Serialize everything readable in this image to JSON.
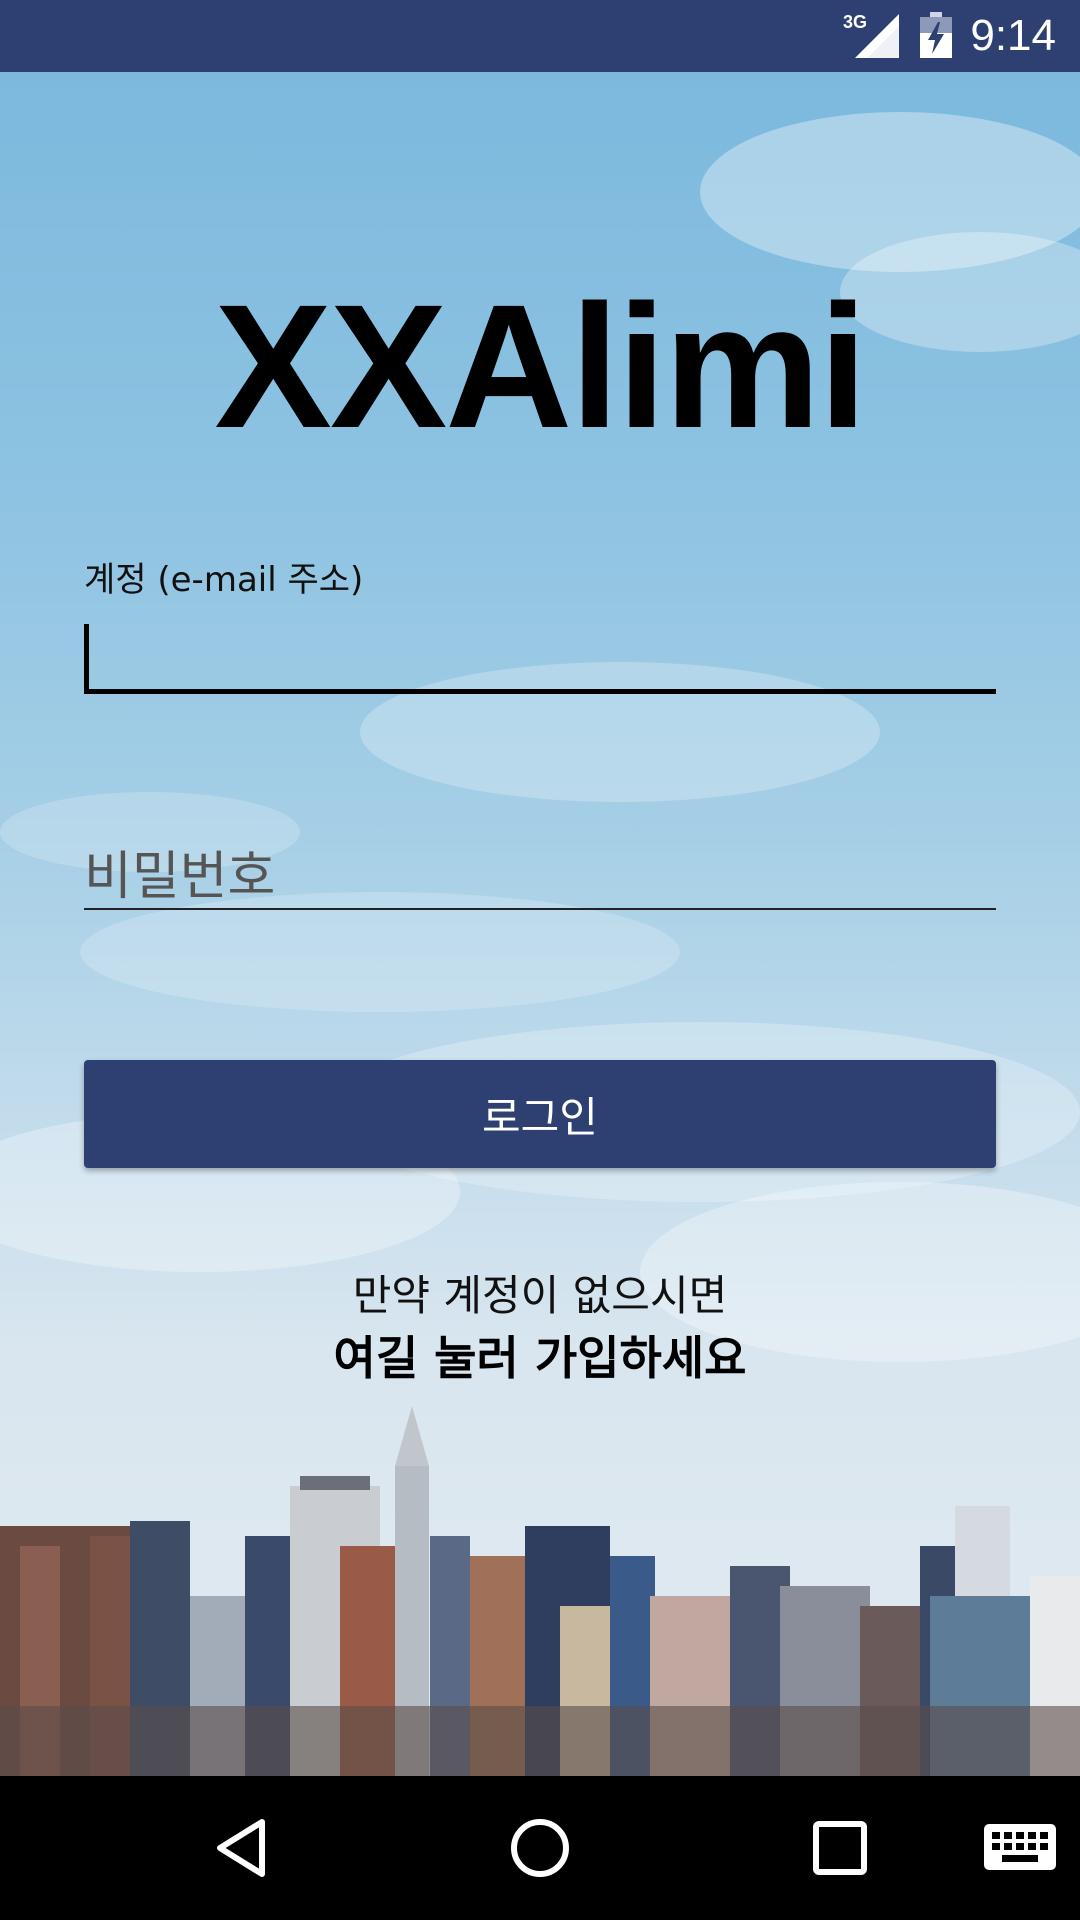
{
  "status_bar": {
    "network": "3G",
    "time": "9:14",
    "icons": [
      "signal-icon",
      "battery-charging-icon"
    ]
  },
  "app": {
    "title": "XXAlimi"
  },
  "login_form": {
    "email_label": "계정 (e-mail 주소)",
    "email_value": "",
    "password_placeholder": "비밀번호",
    "login_button_label": "로그인"
  },
  "signup": {
    "prompt": "만약 계정이 없으시면",
    "link_label": "여길 눌러 가입하세요"
  },
  "nav_bar": {
    "icons": [
      "back-icon",
      "home-icon",
      "recents-icon",
      "keyboard-icon"
    ]
  },
  "colors": {
    "primary": "#2e4072",
    "sky": "#8ec3e2",
    "text": "#000000"
  }
}
